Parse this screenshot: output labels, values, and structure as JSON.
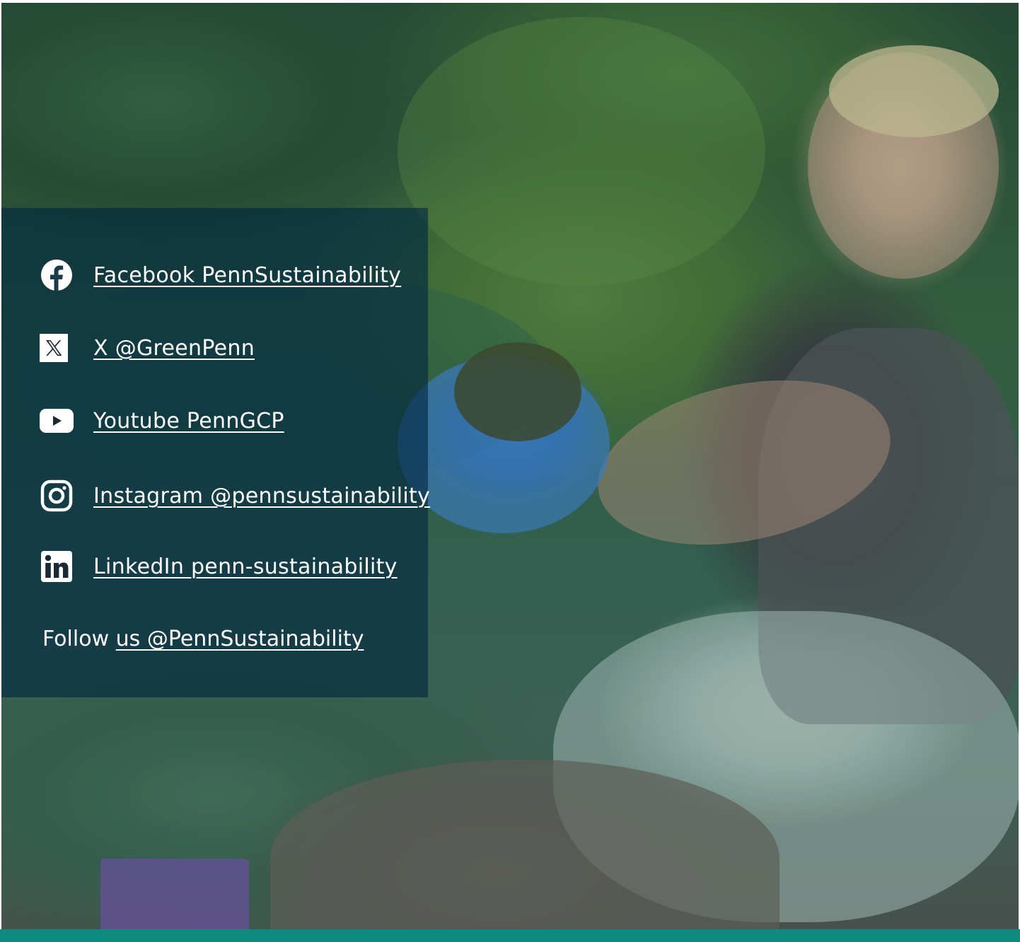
{
  "hero": {
    "image_description": "hero-photo"
  },
  "social": {
    "items": [
      {
        "icon": "facebook-icon",
        "label": "Facebook PennSustainability"
      },
      {
        "icon": "x-icon",
        "label": "X @GreenPenn"
      },
      {
        "icon": "youtube-icon",
        "label": "Youtube PennGCP"
      },
      {
        "icon": "instagram-icon",
        "label": "Instagram @pennsustainability"
      },
      {
        "icon": "linkedin-icon",
        "label": "LinkedIn penn-sustainability"
      }
    ],
    "follow_prefix": "Follow ",
    "follow_link": "us @PennSustainability"
  },
  "colors": {
    "panel_overlay": "#002640",
    "footer_bar": "#0f8a7e",
    "text": "#ffffff"
  }
}
